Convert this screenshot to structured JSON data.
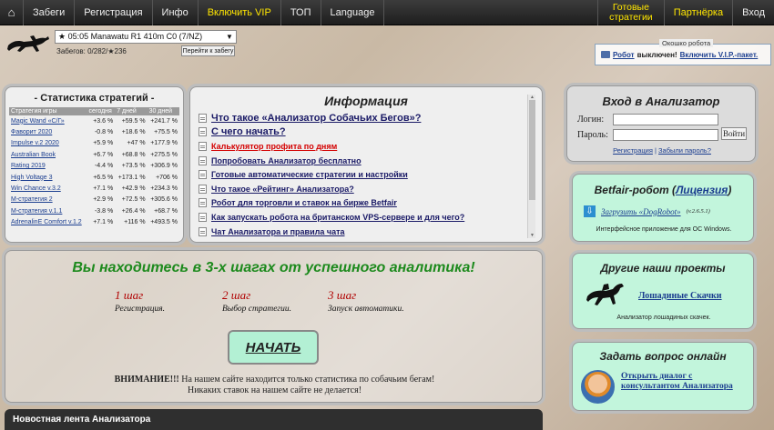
{
  "nav": {
    "home_icon": "⌂",
    "items": [
      "Забеги",
      "Регистрация",
      "Инфо",
      "Включить VIP",
      "ТОП",
      "Language"
    ],
    "ready_line1": "Готовые",
    "ready_line2": "стратегии",
    "partner": "Партнёрка",
    "login": "Вход"
  },
  "header": {
    "race_select_value": "★ 05:05 Manawatu R1 410m C0 (7/NZ)",
    "race_count": "Забегов: 0/282/★236",
    "goto_button": "Перейти к забегу",
    "robot_window_legend": "Окошко робота",
    "robot_link": "Робот",
    "robot_status": "выключен!",
    "vip_link": "Включить V.I.P.-пакет."
  },
  "stats": {
    "title": "- Статистика стратегий -",
    "columns": [
      "Стратегия игры",
      "сегодня",
      "7 дней",
      "30 дней"
    ],
    "rows": [
      [
        "Magic Wand «С/Г»",
        "+3.6 %",
        "+59.5 %",
        "+241.7 %"
      ],
      [
        "Фаворит 2020",
        "-0.8 %",
        "+18.6 %",
        "+75.5 %"
      ],
      [
        "Impulse v.2 2020",
        "+5.9 %",
        "+47 %",
        "+177.9 %"
      ],
      [
        "Australian Book",
        "+6.7 %",
        "+68.8 %",
        "+275.5 %"
      ],
      [
        "Rating 2019",
        "-4.4 %",
        "+73.5 %",
        "+306.9 %"
      ],
      [
        "High Voltage 3",
        "+6.5 %",
        "+173.1 %",
        "+706 %"
      ],
      [
        "Win Chance v.3.2",
        "+7.1 %",
        "+42.9 %",
        "+234.3 %"
      ],
      [
        "М-стратегия 2",
        "+2.9 %",
        "+72.5 %",
        "+305.6 %"
      ],
      [
        "М-стратегия v.1.1",
        "-3.8 %",
        "+26.4 %",
        "+68.7 %"
      ],
      [
        "AdrenalinE Comfort v.1.2",
        "+7.1 %",
        "+116 %",
        "+493.5 %"
      ]
    ]
  },
  "info": {
    "title": "Информация",
    "links": [
      "Что такое «Анализатор Собачьих Бегов»?",
      "С чего начать?",
      "Калькулятор профита по дням",
      "Попробовать Анализатор бесплатно",
      "Готовые автоматические стратегии и настройки",
      "Что такое «Рейтинг» Анализатора?",
      "Робот для торговли и ставок на бирже Betfair",
      "Как запускать робота на британском VPS-сервере и для чего?",
      "Чат Анализатора и правила чата"
    ]
  },
  "steps": {
    "headline": "Вы находитесь в 3-х шагах от успешного аналитика!",
    "items": [
      {
        "title": "1 шаг",
        "desc": "Регистрация."
      },
      {
        "title": "2 шаг",
        "desc": "Выбор стратегии."
      },
      {
        "title": "3 шаг",
        "desc": "Запуск автоматики."
      }
    ],
    "start_button": "НАЧАТЬ",
    "warning_bold": "ВНИМАНИЕ!!!",
    "warning_line1": " На нашем сайте находится только статистика по собачьим бегам!",
    "warning_line2": "Никаких ставок на нашем сайте не делается!"
  },
  "news": {
    "title": "Новостная лента Анализатора"
  },
  "login": {
    "title": "Вход в Анализатор",
    "login_label": "Логин:",
    "password_label": "Пароль:",
    "submit": "Войти",
    "register_link": "Регистрация",
    "forgot_link": "Забыли пароль?"
  },
  "betfair": {
    "title": "Betfair-робот (",
    "license": "Лицензия",
    "title_end": ")",
    "download_link": "Загрузить «DogRobot»",
    "version": "(v.2.6.5.1)",
    "subtitle": "Интерфейсное приложение для ОС Windows."
  },
  "projects": {
    "title": "Другие наши проекты",
    "link": "Лошадиные Скачки",
    "subtitle": "Анализатор лошадиных скачек."
  },
  "ask": {
    "title": "Задать вопрос онлайн",
    "link": "Открыть диалог с консультантом Анализатора"
  }
}
